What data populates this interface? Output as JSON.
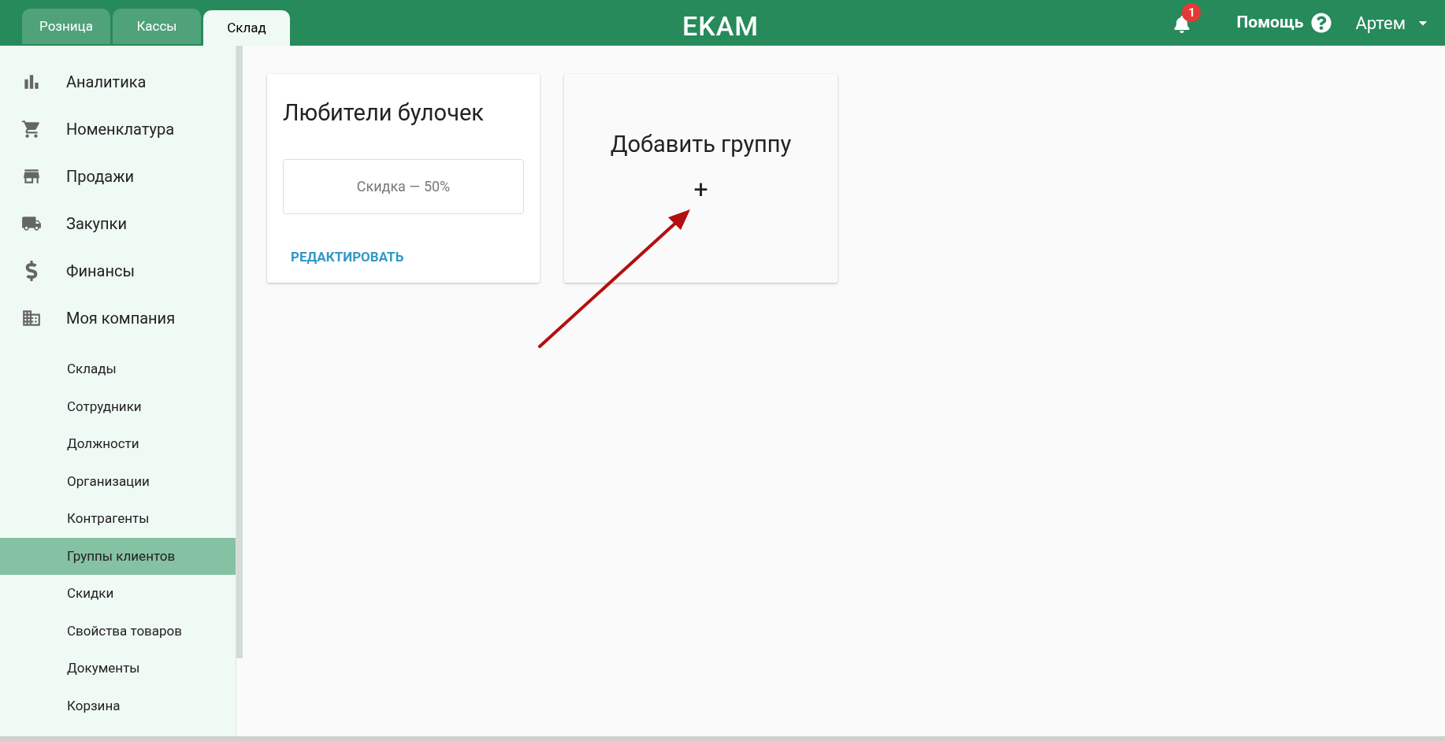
{
  "header": {
    "tabs": [
      {
        "label": "Розница",
        "selected": false
      },
      {
        "label": "Кассы",
        "selected": false
      },
      {
        "label": "Склад",
        "selected": true
      }
    ],
    "logo": "EKAM",
    "notifications": {
      "count": "1"
    },
    "help": "Помощь",
    "user": "Артем"
  },
  "sidebar": {
    "items": [
      {
        "label": "Аналитика"
      },
      {
        "label": "Номенклатура"
      },
      {
        "label": "Продажи"
      },
      {
        "label": "Закупки"
      },
      {
        "label": "Финансы"
      },
      {
        "label": "Моя компания"
      }
    ],
    "subitems": [
      {
        "label": "Склады",
        "selected": false
      },
      {
        "label": "Сотрудники",
        "selected": false
      },
      {
        "label": "Должности",
        "selected": false
      },
      {
        "label": "Организации",
        "selected": false
      },
      {
        "label": "Контрагенты",
        "selected": false
      },
      {
        "label": "Группы клиентов",
        "selected": true
      },
      {
        "label": "Скидки",
        "selected": false
      },
      {
        "label": "Свойства товаров",
        "selected": false
      },
      {
        "label": "Документы",
        "selected": false
      },
      {
        "label": "Корзина",
        "selected": false
      }
    ]
  },
  "groups": [
    {
      "title": "Любители булочек",
      "discount": "Скидка — 50%",
      "action": "РЕДАКТИРОВАТЬ"
    }
  ],
  "add_card": {
    "title": "Добавить группу",
    "plus": "+"
  }
}
